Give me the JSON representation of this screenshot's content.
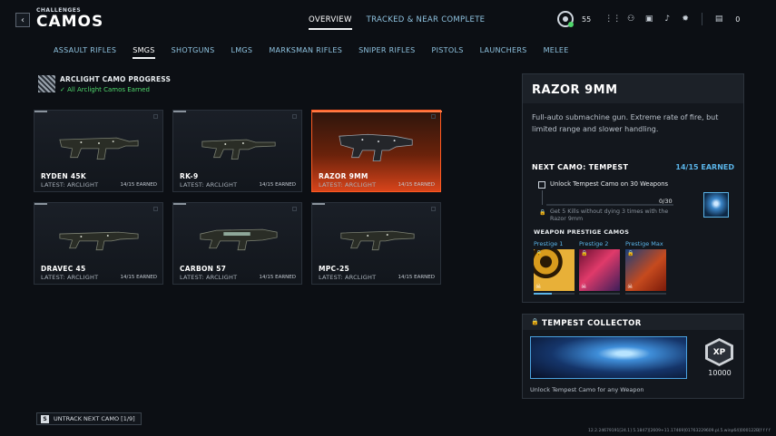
{
  "header": {
    "breadcrumb": "CHALLENGES",
    "title": "CAMOS",
    "back_icon": "‹",
    "tabs": [
      {
        "label": "OVERVIEW",
        "active": true
      },
      {
        "label": "TRACKED & NEAR COMPLETE",
        "active": false
      }
    ],
    "level": "55",
    "currency": "0"
  },
  "categories": [
    {
      "label": "ASSAULT RIFLES",
      "active": false
    },
    {
      "label": "SMGS",
      "active": true
    },
    {
      "label": "SHOTGUNS",
      "active": false
    },
    {
      "label": "LMGS",
      "active": false
    },
    {
      "label": "MARKSMAN RIFLES",
      "active": false
    },
    {
      "label": "SNIPER RIFLES",
      "active": false
    },
    {
      "label": "PISTOLS",
      "active": false
    },
    {
      "label": "LAUNCHERS",
      "active": false
    },
    {
      "label": "MELEE",
      "active": false
    }
  ],
  "arclight": {
    "title": "ARCLIGHT CAMO PROGRESS",
    "status_check": "✓",
    "status": "All Arclight Camos Earned"
  },
  "weapons": [
    {
      "name": "RYDEN 45K",
      "latest": "LATEST: ARCLIGHT",
      "earned": "14/15 EARNED",
      "active": false
    },
    {
      "name": "RK-9",
      "latest": "LATEST: ARCLIGHT",
      "earned": "14/15 EARNED",
      "active": false
    },
    {
      "name": "RAZOR 9MM",
      "latest": "LATEST: ARCLIGHT",
      "earned": "14/15 EARNED",
      "active": true
    },
    {
      "name": "DRAVEC 45",
      "latest": "LATEST: ARCLIGHT",
      "earned": "14/15 EARNED",
      "active": false
    },
    {
      "name": "CARBON 57",
      "latest": "LATEST: ARCLIGHT",
      "earned": "14/15 EARNED",
      "active": false
    },
    {
      "name": "MPC-25",
      "latest": "LATEST: ARCLIGHT",
      "earned": "14/15 EARNED",
      "active": false
    }
  ],
  "untrack": {
    "key": "S",
    "label": "UNTRACK NEXT CAMO [1/9]"
  },
  "detail": {
    "title": "RAZOR 9MM",
    "description": "Full-auto submachine gun. Extreme rate of fire, but limited range and slower handling.",
    "next_camo": "NEXT CAMO: TEMPEST",
    "earned": "14/15 EARNED",
    "challenge_title": "Unlock Tempest Camo on 30 Weapons",
    "challenge_progress_text": "0/30",
    "challenge_progress": 0,
    "challenge_desc": "Get 5 Kills without dying 3 times with the Razor 9mm",
    "lock_icon": "🔒",
    "prestige_heading": "WEAPON PRESTIGE CAMOS",
    "prestige": [
      {
        "label": "Prestige 1",
        "progress": 0.45
      },
      {
        "label": "Prestige 2",
        "progress": 0
      },
      {
        "label": "Prestige Max",
        "progress": 0
      }
    ]
  },
  "collector": {
    "title": "TEMPEST COLLECTOR",
    "xp_badge": "XP",
    "xp_value": "10000",
    "description": "Unlock Tempest Camo for any Weapon"
  },
  "version": "12.2.24679191[24.1] 5.1847][2609+11.17469]01763229609.pl.5.winp64]000122B[f f f f"
}
